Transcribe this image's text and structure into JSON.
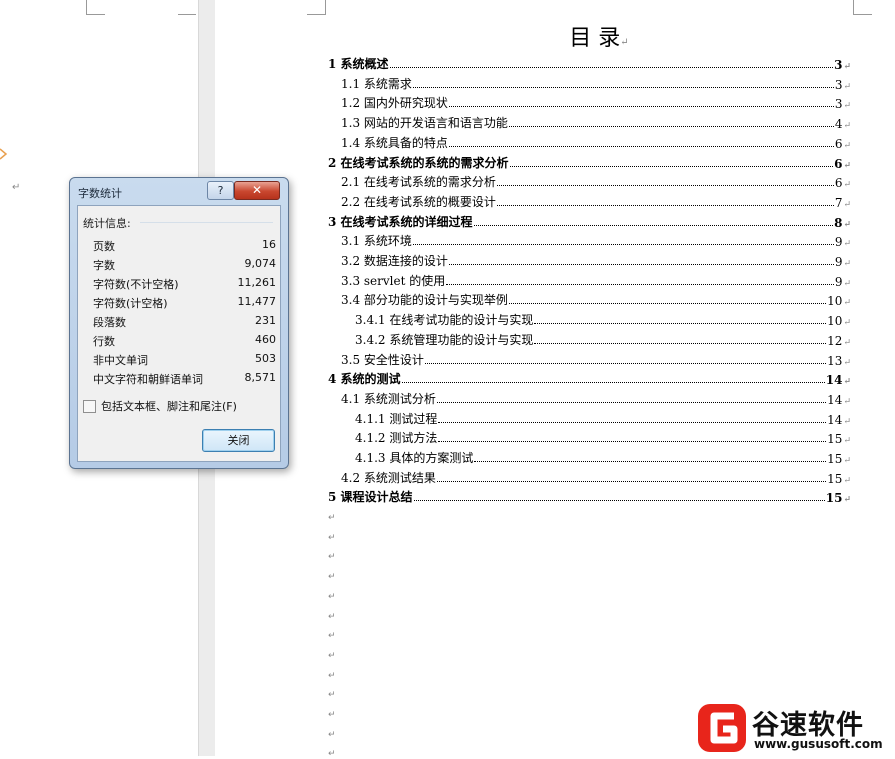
{
  "dialog": {
    "title": "字数统计",
    "help_label": "?",
    "close_x_label": "✕",
    "stats_header": "统计信息:",
    "stats": [
      {
        "label": "页数",
        "value": "16"
      },
      {
        "label": "字数",
        "value": "9,074"
      },
      {
        "label": "字符数(不计空格)",
        "value": "11,261"
      },
      {
        "label": "字符数(计空格)",
        "value": "11,477"
      },
      {
        "label": "段落数",
        "value": "231"
      },
      {
        "label": "行数",
        "value": "460"
      },
      {
        "label": "非中文单词",
        "value": "503"
      },
      {
        "label": "中文字符和朝鲜语单词",
        "value": "8,571"
      }
    ],
    "include_label": "包括文本框、脚注和尾注(F)",
    "include_checked": false,
    "close_button_label": "关闭"
  },
  "toc": {
    "title": "目  录",
    "entries": [
      {
        "level": 1,
        "label": "1  系统概述",
        "page": "3"
      },
      {
        "level": 2,
        "label": "1.1 系统需求",
        "page": "3"
      },
      {
        "level": 2,
        "label": "1.2  国内外研究现状",
        "page": "3"
      },
      {
        "level": 2,
        "label": "1.3 网站的开发语言和语言功能",
        "page": "4"
      },
      {
        "level": 2,
        "label": "1.4  系统具备的特点",
        "page": "6"
      },
      {
        "level": 1,
        "label": "2  在线考试系统的系统的需求分析",
        "page": "6"
      },
      {
        "level": 2,
        "label": "2.1 在线考试系统的需求分析",
        "page": "6"
      },
      {
        "level": 2,
        "label": "2.2 在线考试系统的概要设计",
        "page": "7"
      },
      {
        "level": 1,
        "label": "3  在线考试系统的详细过程",
        "page": "8"
      },
      {
        "level": 2,
        "label": "3.1 系统环境",
        "page": "9"
      },
      {
        "level": 2,
        "label": "3.2 数据连接的设计",
        "page": "9"
      },
      {
        "level": 2,
        "label": "3.3 servlet 的使用",
        "page": "9"
      },
      {
        "level": 2,
        "label": "3.4 部分功能的设计与实现举例",
        "page": "10"
      },
      {
        "level": 3,
        "label": "3.4.1 在线考试功能的设计与实现",
        "page": "10"
      },
      {
        "level": 3,
        "label": "3.4.2 系统管理功能的设计与实现",
        "page": "12"
      },
      {
        "level": 2,
        "label": "3.5 安全性设计",
        "page": "13"
      },
      {
        "level": 1,
        "label": "4  系统的测试",
        "page": "14"
      },
      {
        "level": 2,
        "label": "4.1 系统测试分析",
        "page": "14"
      },
      {
        "level": 3,
        "label": "4.1.1 测试过程",
        "page": "14"
      },
      {
        "level": 3,
        "label": "4.1.2  测试方法",
        "page": "15"
      },
      {
        "level": 3,
        "label": "4.1.3  具体的方案测试",
        "page": "15"
      },
      {
        "level": 2,
        "label": "4.2  系统测试结果",
        "page": "15"
      },
      {
        "level": 1,
        "label": "5  课程设计总结",
        "page": "15"
      }
    ]
  },
  "paragraph_mark": "↵",
  "watermark": {
    "name": "谷速软件",
    "url": "www.gususoft.com",
    "brand_color": "#e8251b"
  }
}
